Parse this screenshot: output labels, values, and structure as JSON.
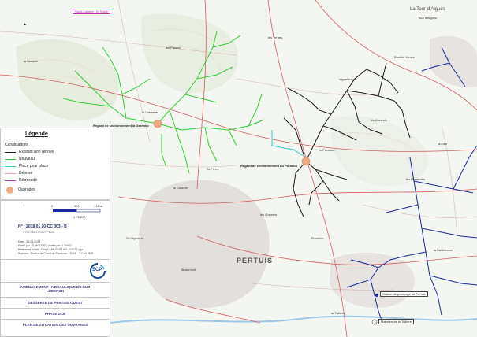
{
  "map": {
    "top_box_label": "Saint-Lazaire - Bl Soleil",
    "place_top_right": "La Tour-d'Aigues",
    "place_center": "PERTUIS",
    "ouvrages": [
      {
        "label": "Regard de sectionnement la Garenne"
      },
      {
        "label": "Regard de sectionnement du Paradou"
      }
    ],
    "callouts": [
      {
        "label": "Station de pompage de Pertuis"
      },
      {
        "label": "Maintien de la Tuilière"
      }
    ],
    "place_names": [
      "Tour d'Aigues",
      "les Plaines",
      "les Ternes",
      "St-Pierre",
      "Vignelongue",
      "la Boraine",
      "Bastide Neuve",
      "la Garenne",
      "le Paradou",
      "les Gonnets",
      "le Castelet",
      "Beaumont",
      "St-Sépulcre",
      "la Tuilière",
      "Moutte",
      "les Plantades",
      "la Bastidonne",
      "Roseline",
      "les Arnauds"
    ]
  },
  "legend": {
    "title": "Légende",
    "subtitle": "Canalisations",
    "items": [
      {
        "label": "Existant non rénové",
        "color": "#1a1a1a",
        "kind": "line"
      },
      {
        "label": "Nouveau",
        "color": "#33cc33",
        "kind": "line"
      },
      {
        "label": "Place pour place",
        "color": "#33cccc",
        "kind": "line"
      },
      {
        "label": "Déposé",
        "color": "#e6a0c8",
        "kind": "line"
      },
      {
        "label": "Rétrocédé",
        "color": "#b030b0",
        "kind": "line"
      },
      {
        "label": "Ouvrages",
        "color": "#f0a880",
        "kind": "dot"
      }
    ]
  },
  "scale": {
    "labels": [
      "0",
      "500",
      "100 m"
    ],
    "ratio": "1 / 5 000"
  },
  "cartouche": {
    "plan_number": "N° : 2018 01 20-CC 003 - B",
    "plan_number_caption": "N°plan   Affaire   Phase   N°   Indice",
    "date": "Date : 05-08-2023",
    "etabli_par": "Etabli par : G.MOUGEL   Vérifié par : LTHAO",
    "reference": "Référence fichier : Projet LAN-PERTUIS-OUEST.qgz",
    "sources": "Sources : Station de Canal de Provence - ©IGN - SCAN 25 ®",
    "logo_text": "SCP",
    "titles": [
      "AMENAGEMENT HYDRAULIQUE DU SUD LUBERON",
      "DESSERTE DE PERTUIS OUEST",
      "PHASE DCE",
      "PLAN DE SITUATION DES OUVRAGES"
    ]
  },
  "colors": {
    "existing": "#1a1a1a",
    "new": "#33cc33",
    "replacement": "#33cccc",
    "blue_network": "#1a2a9a",
    "ouvrage": "#f0a880",
    "roads": "#d06060"
  }
}
